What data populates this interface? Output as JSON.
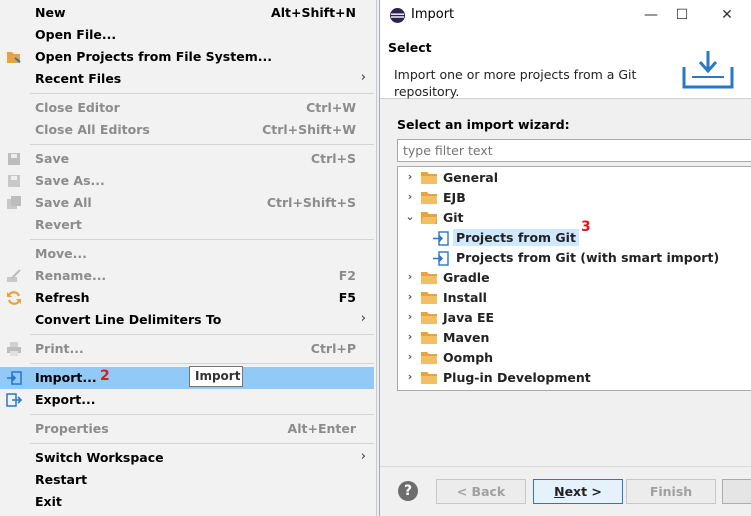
{
  "menu": {
    "items": [
      {
        "label": "New",
        "shortcut": "Alt+Shift+N",
        "submenu": true,
        "disabled": false
      },
      {
        "label": "Open File...",
        "shortcut": "",
        "disabled": false
      },
      {
        "label": "Open Projects from File System...",
        "shortcut": "",
        "disabled": false
      },
      {
        "label": "Recent Files",
        "shortcut": "",
        "submenu": true,
        "disabled": false
      },
      {
        "label": "Close Editor",
        "shortcut": "Ctrl+W",
        "disabled": true
      },
      {
        "label": "Close All Editors",
        "shortcut": "Ctrl+Shift+W",
        "disabled": true
      },
      {
        "label": "Save",
        "shortcut": "Ctrl+S",
        "disabled": true
      },
      {
        "label": "Save As...",
        "shortcut": "",
        "disabled": true
      },
      {
        "label": "Save All",
        "shortcut": "Ctrl+Shift+S",
        "disabled": true
      },
      {
        "label": "Revert",
        "shortcut": "",
        "disabled": true
      },
      {
        "label": "Move...",
        "shortcut": "",
        "disabled": true
      },
      {
        "label": "Rename...",
        "shortcut": "F2",
        "disabled": true
      },
      {
        "label": "Refresh",
        "shortcut": "F5",
        "disabled": false
      },
      {
        "label": "Convert Line Delimiters To",
        "shortcut": "",
        "submenu": true,
        "disabled": false
      },
      {
        "label": "Print...",
        "shortcut": "Ctrl+P",
        "disabled": true
      },
      {
        "label": "Import...",
        "shortcut": "",
        "disabled": false,
        "highlighted": true
      },
      {
        "label": "Export...",
        "shortcut": "",
        "disabled": false
      },
      {
        "label": "Properties",
        "shortcut": "Alt+Enter",
        "disabled": true
      },
      {
        "label": "Switch Workspace",
        "shortcut": "",
        "submenu": true,
        "disabled": false
      },
      {
        "label": "Restart",
        "shortcut": "",
        "disabled": false
      },
      {
        "label": "Exit",
        "shortcut": "",
        "disabled": false
      }
    ],
    "submenu_arrow": "›",
    "step_badge": "2",
    "tooltip": "Import"
  },
  "dialog": {
    "title": "Import",
    "minimize": "—",
    "maximize": "☐",
    "close": "✕",
    "header_title": "Select",
    "header_description": "Import one or more projects from a Git repository.",
    "wizard_label": "Select an import wizard:",
    "filter_placeholder": "type filter text",
    "tree": [
      {
        "label": "General",
        "expanded": false
      },
      {
        "label": "EJB",
        "expanded": false
      },
      {
        "label": "Git",
        "expanded": true,
        "children": [
          {
            "label": "Projects from Git",
            "selected": true
          },
          {
            "label": "Projects from Git (with smart import)",
            "selected": false
          }
        ]
      },
      {
        "label": "Gradle",
        "expanded": false
      },
      {
        "label": "Install",
        "expanded": false
      },
      {
        "label": "Java EE",
        "expanded": false
      },
      {
        "label": "Maven",
        "expanded": false
      },
      {
        "label": "Oomph",
        "expanded": false
      },
      {
        "label": "Plug-in Development",
        "expanded": false
      }
    ],
    "step_badge": "3",
    "collapsed_twisty": "›",
    "expanded_twisty": "⌄",
    "buttons": {
      "help": "?",
      "back": "< Back",
      "next_mnemonic": "N",
      "next_rest": "ext >",
      "finish": "Finish"
    }
  },
  "colors": {
    "highlight": "#91c9f7",
    "selection": "#cde8ff",
    "badge": "#e01818",
    "folder": "#e8a33d"
  }
}
